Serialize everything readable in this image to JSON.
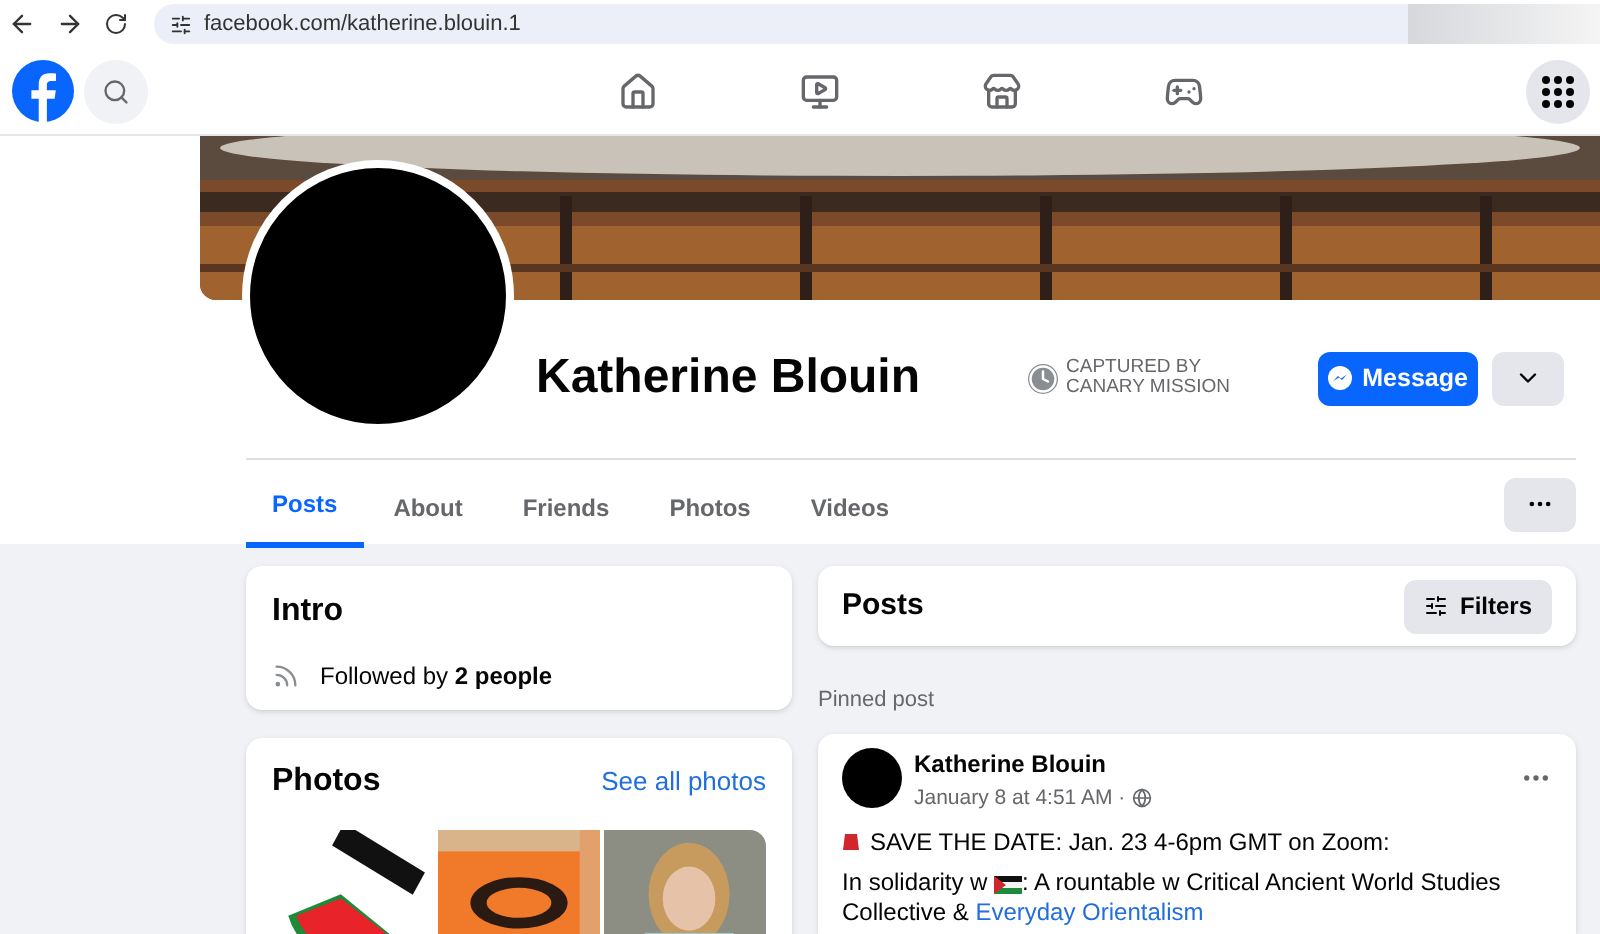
{
  "browser": {
    "url": "facebook.com/katherine.blouin.1"
  },
  "profile": {
    "name": "Katherine Blouin",
    "badge_lines": [
      "CAPTURED BY",
      "CANARY MISSION"
    ],
    "message_button": "Message"
  },
  "tabs": [
    {
      "label": "Posts",
      "selected": true
    },
    {
      "label": "About",
      "selected": false
    },
    {
      "label": "Friends",
      "selected": false
    },
    {
      "label": "Photos",
      "selected": false
    },
    {
      "label": "Videos",
      "selected": false
    }
  ],
  "intro": {
    "title": "Intro",
    "followed": "Followed by **2 people**"
  },
  "photos": {
    "title": "Photos",
    "link": "See all photos"
  },
  "posts_header": {
    "title": "Posts",
    "filters": "Filters"
  },
  "pinned_label": "Pinned post",
  "post": {
    "author": "Katherine Blouin",
    "time": "January 8 at 4:51 AM ·",
    "line_1": "SAVE THE DATE: Jan. 23 4-6pm GMT on Zoom:",
    "line_2_start": "In solidarity w",
    "line_2_rest": ": A rountable w Critical Ancient World Studies Collective &",
    "link": "Everyday Orientalism"
  }
}
